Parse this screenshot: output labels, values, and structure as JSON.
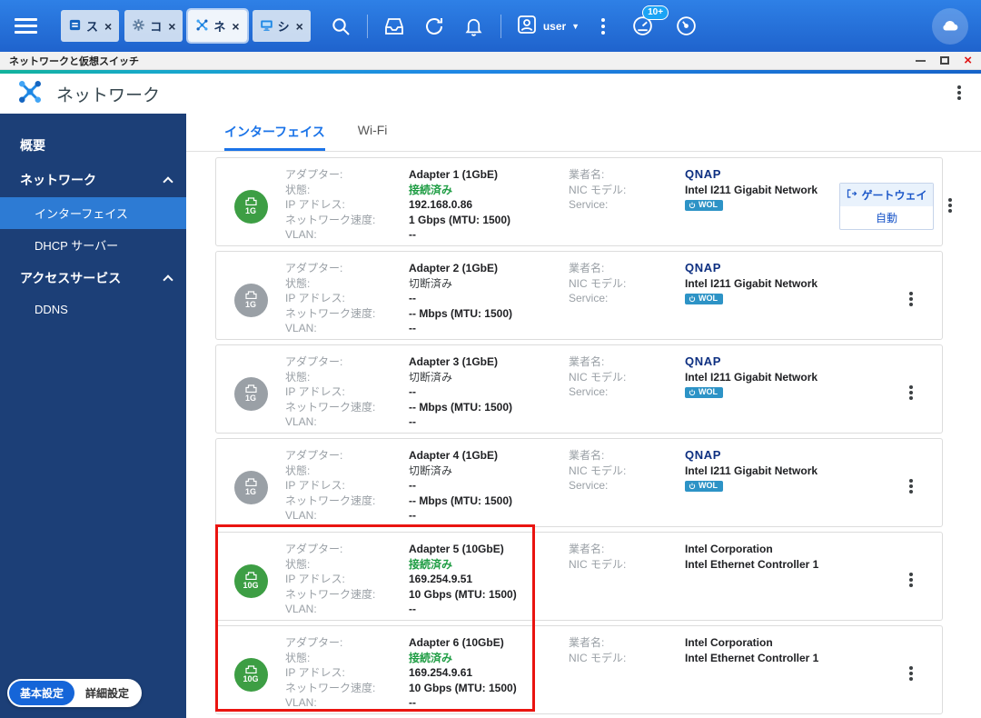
{
  "taskbar": {
    "tabs": [
      {
        "label": "ス"
      },
      {
        "label": "コ"
      },
      {
        "label": "ネ"
      },
      {
        "label": "シ"
      }
    ],
    "user_label": "user",
    "notification_badge": "10+"
  },
  "icons": {
    "close": "×",
    "window_close": "×",
    "caret": "▼"
  },
  "titlebar": {
    "title": "ネットワークと仮想スイッチ"
  },
  "app_header": {
    "title": "ネットワーク"
  },
  "sidebar": {
    "overview": "概要",
    "network_group": "ネットワーク",
    "interfaces": "インターフェイス",
    "dhcp": "DHCP サーバー",
    "access_group": "アクセスサービス",
    "ddns": "DDNS",
    "basic_settings": "基本設定",
    "advanced_settings": "詳細設定"
  },
  "main": {
    "tabs": {
      "interfaces": "インターフェイス",
      "wifi": "Wi-Fi"
    },
    "labels": {
      "adapter": "アダプター:",
      "status": "状態:",
      "ip": "IP アドレス:",
      "speed": "ネットワーク速度:",
      "vlan": "VLAN:",
      "vendor": "業者名:",
      "nic_model": "NIC モデル:",
      "service": "Service:"
    },
    "wol_label": "WOL",
    "gateway": {
      "label": "ゲートウェイ",
      "value": "自動"
    },
    "adapters": [
      {
        "badge": "1G",
        "name": "Adapter 1 (1GbE)",
        "status": "接続済み",
        "ip": "192.168.0.86",
        "speed": "1 Gbps (MTU: 1500)",
        "vlan": "--",
        "vendor": "QNAP",
        "nic": "Intel I211 Gigabit Network"
      },
      {
        "badge": "1G",
        "name": "Adapter 2 (1GbE)",
        "status": "切断済み",
        "ip": "--",
        "speed": "-- Mbps (MTU: 1500)",
        "vlan": "--",
        "vendor": "QNAP",
        "nic": "Intel I211 Gigabit Network"
      },
      {
        "badge": "1G",
        "name": "Adapter 3 (1GbE)",
        "status": "切断済み",
        "ip": "--",
        "speed": "-- Mbps (MTU: 1500)",
        "vlan": "--",
        "vendor": "QNAP",
        "nic": "Intel I211 Gigabit Network"
      },
      {
        "badge": "1G",
        "name": "Adapter 4 (1GbE)",
        "status": "切断済み",
        "ip": "--",
        "speed": "-- Mbps (MTU: 1500)",
        "vlan": "--",
        "vendor": "QNAP",
        "nic": "Intel I211 Gigabit Network"
      },
      {
        "badge": "10G",
        "name": "Adapter 5 (10GbE)",
        "status": "接続済み",
        "ip": "169.254.9.51",
        "speed": "10 Gbps (MTU: 1500)",
        "vlan": "--",
        "vendor": "Intel Corporation",
        "nic": "Intel Ethernet Controller 1"
      },
      {
        "badge": "10G",
        "name": "Adapter 6 (10GbE)",
        "status": "接続済み",
        "ip": "169.254.9.61",
        "speed": "10 Gbps (MTU: 1500)",
        "vlan": "--",
        "vendor": "Intel Corporation",
        "nic": "Intel Ethernet Controller 1"
      }
    ]
  }
}
